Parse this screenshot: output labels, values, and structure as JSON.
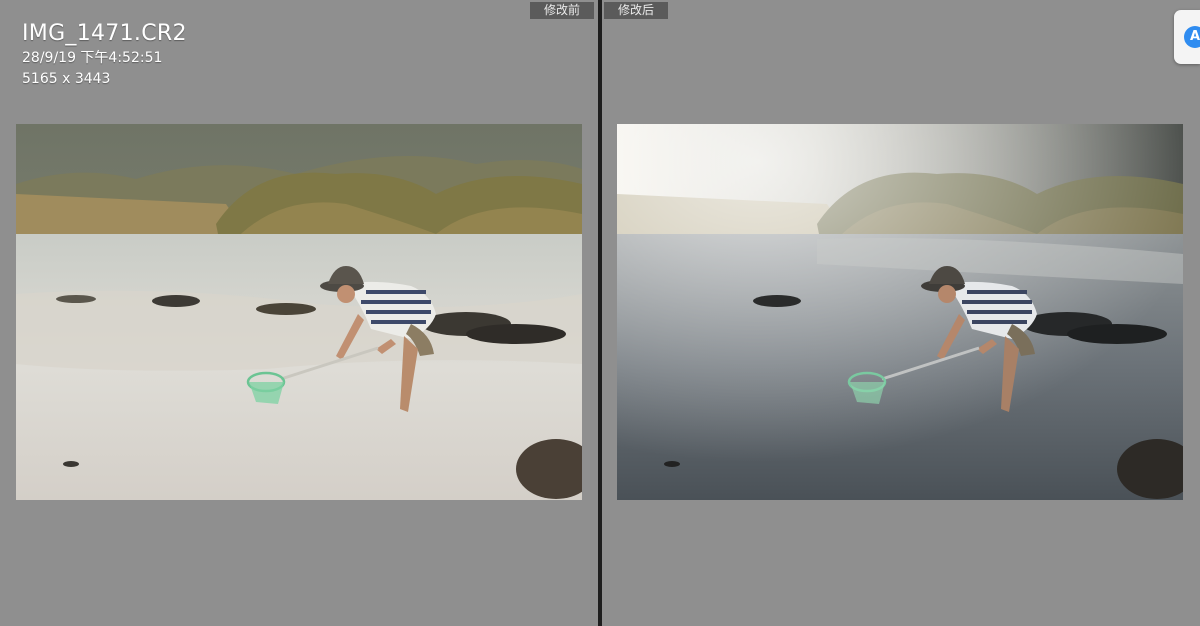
{
  "compare": {
    "before_label": "修改前",
    "after_label": "修改后"
  },
  "file_info": {
    "filename": "IMG_1471.CR2",
    "datetime": "28/9/19 下午4:52:51",
    "dimensions": "5165 x 3443"
  },
  "photos": {
    "before": {
      "description_icon": "photo-before"
    },
    "after": {
      "description_icon": "photo-after"
    }
  },
  "side_button": {
    "icon": "app-store-icon",
    "glyph": "A"
  },
  "colors": {
    "pane_bg": "#8f8f8f",
    "divider": "#1e1e1e",
    "label_bg": "#5b5b5b"
  }
}
